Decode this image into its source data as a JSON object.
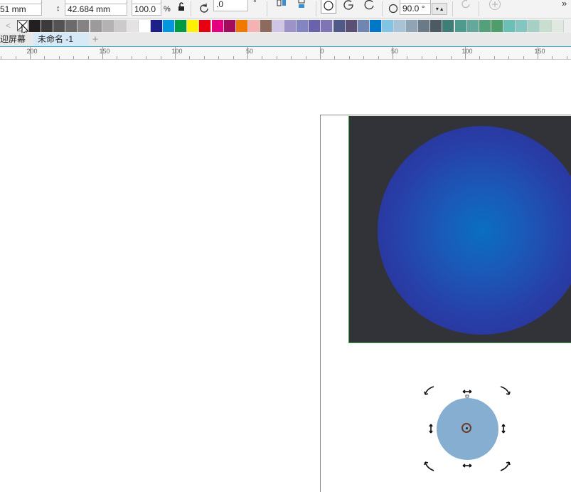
{
  "propbar": {
    "x_value": "51 mm",
    "height_value": "42.684 mm",
    "scale_value": "100.0",
    "percent_label": "%",
    "rotation_value": ".0",
    "angle_value": "90.0 °"
  },
  "palette": {
    "colors": [
      "#231f20",
      "#3d3a3b",
      "#555254",
      "#6d6a6b",
      "#858283",
      "#9c9a9b",
      "#b4b2b3",
      "#cccacb",
      "#e4e2e3",
      "#ffffff",
      "#1d2088",
      "#0097e0",
      "#009944",
      "#fff100",
      "#e60012",
      "#e4007f",
      "#a40b5d",
      "#ee7800",
      "#f5b2b2",
      "#8c6b5e",
      "#cfc6e6",
      "#9d93c9",
      "#8186c3",
      "#6a63ab",
      "#7f74b5",
      "#4f5a8a",
      "#5a4f74",
      "#6f87b0",
      "#0077c8",
      "#82c4e4",
      "#a8c2d6",
      "#8fa5b5",
      "#6a7a86",
      "#4b5a63",
      "#3e7e77",
      "#4e9a8c",
      "#64a89b",
      "#54a07a",
      "#4d9e6b",
      "#6bbfb5",
      "#83c5c0",
      "#a7d0c4",
      "#c8dfd0",
      "#dfe9e0"
    ],
    "nav_prev": "<"
  },
  "tabs": [
    {
      "label": "迎屏幕"
    },
    {
      "label": "未命名 -1"
    }
  ],
  "tab_add": "+",
  "ruler": {
    "labels": [
      "200",
      "150",
      "100",
      "50",
      "0",
      "50",
      "100",
      "150"
    ]
  },
  "icons": {
    "lock": "lock-icon",
    "rotate": "rotate-icon",
    "circle_tool": "circle-icon",
    "arc_tool": "arc-icon",
    "pie_tool": "pie-icon",
    "add": "add-icon",
    "more": "chevron-right-icon"
  },
  "colors": {
    "accent": "#2aa6c8",
    "canvas_bg": "#ffffff",
    "image_bg": "#323338",
    "small_circle": "#86aed0"
  }
}
